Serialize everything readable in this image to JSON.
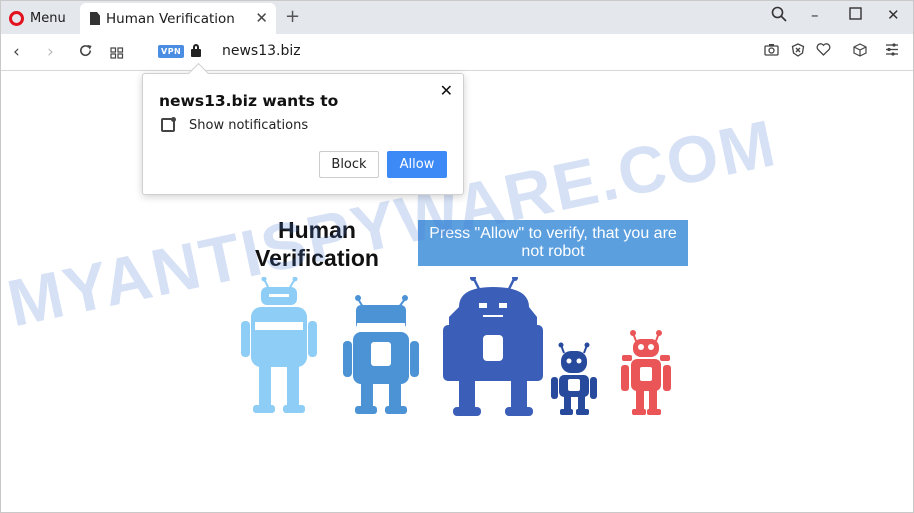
{
  "browser": {
    "menu_label": "Menu",
    "tab_title": "Human Verification",
    "vpn_badge": "VPN",
    "url": "news13.biz"
  },
  "popup": {
    "title": "news13.biz wants to",
    "description": "Show notifications",
    "block_label": "Block",
    "allow_label": "Allow"
  },
  "page": {
    "headline": "Human Verification",
    "instruction": "Press \"Allow\" to verify, that you are not robot",
    "watermark": "MYANTISPYWARE.COM"
  },
  "colors": {
    "robot_light": "#8ecdf5",
    "robot_mid": "#4c93d6",
    "robot_dark": "#3b5fb8",
    "robot_navy": "#274a9c",
    "robot_red": "#ea5558",
    "allow_button": "#3d8af7",
    "instruction_bg": "#5b9fdf"
  }
}
